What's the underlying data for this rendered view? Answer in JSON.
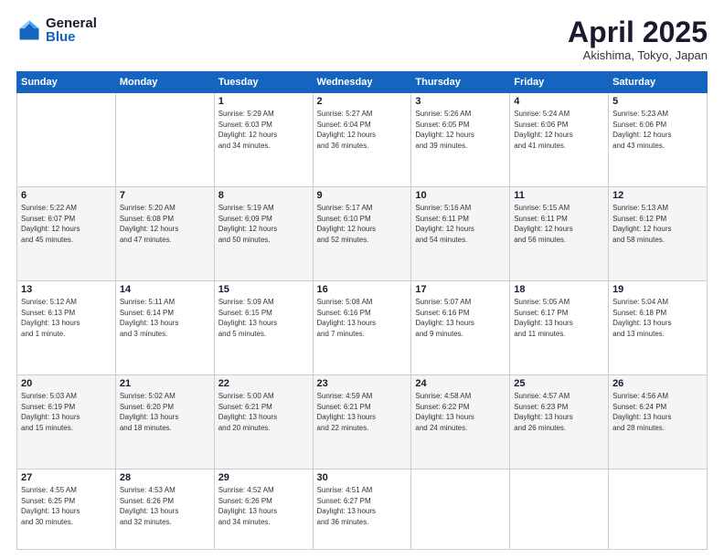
{
  "logo": {
    "general": "General",
    "blue": "Blue"
  },
  "header": {
    "title": "April 2025",
    "location": "Akishima, Tokyo, Japan"
  },
  "weekdays": [
    "Sunday",
    "Monday",
    "Tuesday",
    "Wednesday",
    "Thursday",
    "Friday",
    "Saturday"
  ],
  "rows": [
    [
      {
        "day": "",
        "info": ""
      },
      {
        "day": "",
        "info": ""
      },
      {
        "day": "1",
        "info": "Sunrise: 5:29 AM\nSunset: 6:03 PM\nDaylight: 12 hours\nand 34 minutes."
      },
      {
        "day": "2",
        "info": "Sunrise: 5:27 AM\nSunset: 6:04 PM\nDaylight: 12 hours\nand 36 minutes."
      },
      {
        "day": "3",
        "info": "Sunrise: 5:26 AM\nSunset: 6:05 PM\nDaylight: 12 hours\nand 39 minutes."
      },
      {
        "day": "4",
        "info": "Sunrise: 5:24 AM\nSunset: 6:06 PM\nDaylight: 12 hours\nand 41 minutes."
      },
      {
        "day": "5",
        "info": "Sunrise: 5:23 AM\nSunset: 6:06 PM\nDaylight: 12 hours\nand 43 minutes."
      }
    ],
    [
      {
        "day": "6",
        "info": "Sunrise: 5:22 AM\nSunset: 6:07 PM\nDaylight: 12 hours\nand 45 minutes."
      },
      {
        "day": "7",
        "info": "Sunrise: 5:20 AM\nSunset: 6:08 PM\nDaylight: 12 hours\nand 47 minutes."
      },
      {
        "day": "8",
        "info": "Sunrise: 5:19 AM\nSunset: 6:09 PM\nDaylight: 12 hours\nand 50 minutes."
      },
      {
        "day": "9",
        "info": "Sunrise: 5:17 AM\nSunset: 6:10 PM\nDaylight: 12 hours\nand 52 minutes."
      },
      {
        "day": "10",
        "info": "Sunrise: 5:16 AM\nSunset: 6:11 PM\nDaylight: 12 hours\nand 54 minutes."
      },
      {
        "day": "11",
        "info": "Sunrise: 5:15 AM\nSunset: 6:11 PM\nDaylight: 12 hours\nand 56 minutes."
      },
      {
        "day": "12",
        "info": "Sunrise: 5:13 AM\nSunset: 6:12 PM\nDaylight: 12 hours\nand 58 minutes."
      }
    ],
    [
      {
        "day": "13",
        "info": "Sunrise: 5:12 AM\nSunset: 6:13 PM\nDaylight: 13 hours\nand 1 minute."
      },
      {
        "day": "14",
        "info": "Sunrise: 5:11 AM\nSunset: 6:14 PM\nDaylight: 13 hours\nand 3 minutes."
      },
      {
        "day": "15",
        "info": "Sunrise: 5:09 AM\nSunset: 6:15 PM\nDaylight: 13 hours\nand 5 minutes."
      },
      {
        "day": "16",
        "info": "Sunrise: 5:08 AM\nSunset: 6:16 PM\nDaylight: 13 hours\nand 7 minutes."
      },
      {
        "day": "17",
        "info": "Sunrise: 5:07 AM\nSunset: 6:16 PM\nDaylight: 13 hours\nand 9 minutes."
      },
      {
        "day": "18",
        "info": "Sunrise: 5:05 AM\nSunset: 6:17 PM\nDaylight: 13 hours\nand 11 minutes."
      },
      {
        "day": "19",
        "info": "Sunrise: 5:04 AM\nSunset: 6:18 PM\nDaylight: 13 hours\nand 13 minutes."
      }
    ],
    [
      {
        "day": "20",
        "info": "Sunrise: 5:03 AM\nSunset: 6:19 PM\nDaylight: 13 hours\nand 15 minutes."
      },
      {
        "day": "21",
        "info": "Sunrise: 5:02 AM\nSunset: 6:20 PM\nDaylight: 13 hours\nand 18 minutes."
      },
      {
        "day": "22",
        "info": "Sunrise: 5:00 AM\nSunset: 6:21 PM\nDaylight: 13 hours\nand 20 minutes."
      },
      {
        "day": "23",
        "info": "Sunrise: 4:59 AM\nSunset: 6:21 PM\nDaylight: 13 hours\nand 22 minutes."
      },
      {
        "day": "24",
        "info": "Sunrise: 4:58 AM\nSunset: 6:22 PM\nDaylight: 13 hours\nand 24 minutes."
      },
      {
        "day": "25",
        "info": "Sunrise: 4:57 AM\nSunset: 6:23 PM\nDaylight: 13 hours\nand 26 minutes."
      },
      {
        "day": "26",
        "info": "Sunrise: 4:56 AM\nSunset: 6:24 PM\nDaylight: 13 hours\nand 28 minutes."
      }
    ],
    [
      {
        "day": "27",
        "info": "Sunrise: 4:55 AM\nSunset: 6:25 PM\nDaylight: 13 hours\nand 30 minutes."
      },
      {
        "day": "28",
        "info": "Sunrise: 4:53 AM\nSunset: 6:26 PM\nDaylight: 13 hours\nand 32 minutes."
      },
      {
        "day": "29",
        "info": "Sunrise: 4:52 AM\nSunset: 6:26 PM\nDaylight: 13 hours\nand 34 minutes."
      },
      {
        "day": "30",
        "info": "Sunrise: 4:51 AM\nSunset: 6:27 PM\nDaylight: 13 hours\nand 36 minutes."
      },
      {
        "day": "",
        "info": ""
      },
      {
        "day": "",
        "info": ""
      },
      {
        "day": "",
        "info": ""
      }
    ]
  ]
}
